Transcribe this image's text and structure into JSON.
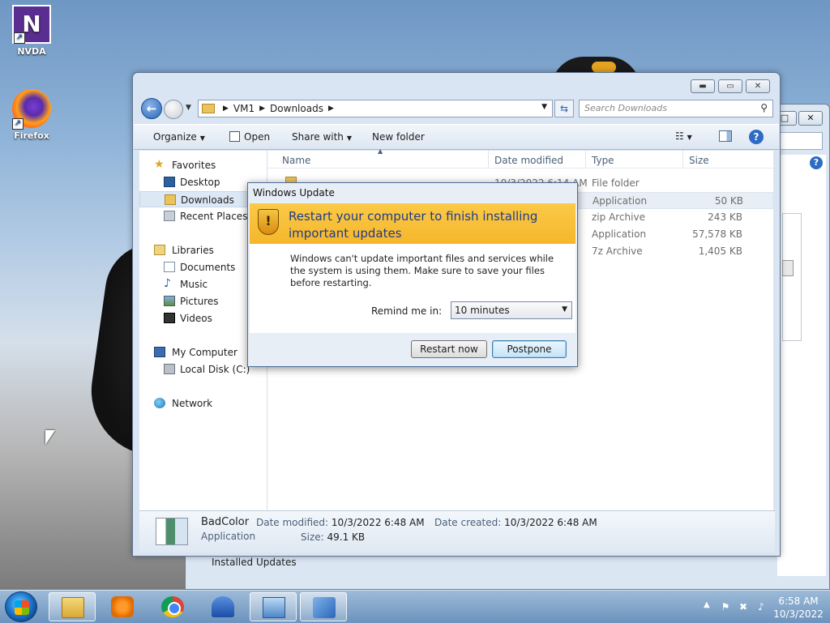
{
  "desktop": {
    "icons": [
      {
        "label": "NVDA"
      },
      {
        "label": "Firefox"
      }
    ]
  },
  "back_window": {
    "label": "Installed Updates"
  },
  "explorer": {
    "address": {
      "root": "VM1",
      "folder": "Downloads"
    },
    "search_placeholder": "Search Downloads",
    "toolbar": {
      "organize": "Organize",
      "open": "Open",
      "share_with": "Share with",
      "new_folder": "New folder"
    },
    "nav": {
      "favorites": "Favorites",
      "desktop": "Desktop",
      "downloads": "Downloads",
      "recent_places": "Recent Places",
      "libraries": "Libraries",
      "documents": "Documents",
      "music": "Music",
      "pictures": "Pictures",
      "videos": "Videos",
      "my_computer": "My Computer",
      "local_disk": "Local Disk (C:)",
      "network": "Network"
    },
    "columns": {
      "name": "Name",
      "date_modified": "Date modified",
      "type": "Type",
      "size": "Size"
    },
    "rows": [
      {
        "date": "10/3/2022 6:14 AM",
        "type": "File folder",
        "size": ""
      },
      {
        "date": "",
        "type": "Application",
        "size": "50 KB"
      },
      {
        "date": "",
        "type": "zip Archive",
        "size": "243 KB"
      },
      {
        "date": "",
        "type": "Application",
        "size": "57,578 KB"
      },
      {
        "date": "",
        "type": "7z Archive",
        "size": "1,405 KB"
      }
    ],
    "details": {
      "name": "BadColor",
      "kind": "Application",
      "date_modified_label": "Date modified:",
      "date_modified": "10/3/2022 6:48 AM",
      "date_created_label": "Date created:",
      "date_created": "10/3/2022 6:48 AM",
      "size_label": "Size:",
      "size": "49.1 KB"
    }
  },
  "dialog": {
    "title": "Windows Update",
    "heading": "Restart your computer to finish installing important updates",
    "message": "Windows can't update important files and services while the system is using them. Make sure to save your files before restarting.",
    "remind_label": "Remind me in:",
    "remind_value": "10 minutes",
    "restart_button": "Restart now",
    "postpone_button": "Postpone"
  },
  "taskbar": {
    "time": "6:58 AM",
    "date": "10/3/2022"
  }
}
